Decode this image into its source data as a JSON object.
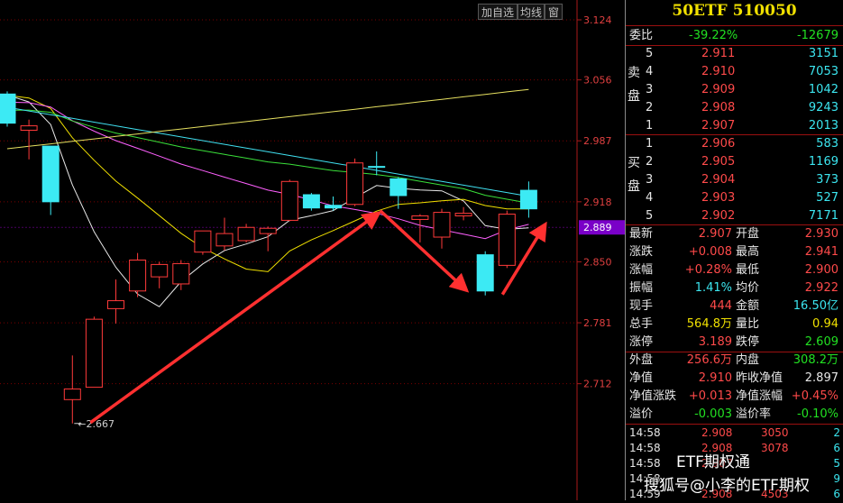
{
  "toolbar": {
    "add_watchlist": "加自选",
    "ma_line": "均线",
    "window": "窗"
  },
  "chart_data": {
    "type": "candlestick",
    "y_ticks": [
      "3.124",
      "3.056",
      "2.987",
      "2.918",
      "2.850",
      "2.781",
      "2.712"
    ],
    "ylim": [
      2.65,
      3.124
    ],
    "current_price_label": "2.889",
    "low_annotation": "2.667",
    "colors": {
      "up": "#ff3a3a",
      "down": "#3ceaf4",
      "grid": "#7a0000",
      "ma5": "#e8e8e8",
      "ma10": "#f0e000",
      "ma20": "#ff60ff",
      "ma30": "#3ae03a",
      "ma60": "#40e0f0",
      "ma120": "#e6e060",
      "current": "#7a00c8",
      "arrow": "#ff3030"
    },
    "candles": [
      {
        "o": 3.04,
        "h": 3.043,
        "c": 3.007,
        "l": 3.003
      },
      {
        "o": 2.999,
        "h": 3.011,
        "c": 3.004,
        "l": 2.966
      },
      {
        "o": 2.981,
        "h": 2.981,
        "c": 2.918,
        "l": 2.903
      },
      {
        "o": 2.694,
        "h": 2.744,
        "c": 2.706,
        "l": 2.667
      },
      {
        "o": 2.708,
        "h": 2.788,
        "c": 2.785,
        "l": 2.708
      },
      {
        "o": 2.797,
        "h": 2.83,
        "c": 2.806,
        "l": 2.78
      },
      {
        "o": 2.817,
        "h": 2.86,
        "c": 2.852,
        "l": 2.81
      },
      {
        "o": 2.833,
        "h": 2.85,
        "c": 2.847,
        "l": 2.82
      },
      {
        "o": 2.825,
        "h": 2.852,
        "c": 2.848,
        "l": 2.818
      },
      {
        "o": 2.861,
        "h": 2.88,
        "c": 2.885,
        "l": 2.858
      },
      {
        "o": 2.868,
        "h": 2.9,
        "c": 2.882,
        "l": 2.863
      },
      {
        "o": 2.874,
        "h": 2.893,
        "c": 2.889,
        "l": 2.872
      },
      {
        "o": 2.882,
        "h": 2.89,
        "c": 2.888,
        "l": 2.862
      },
      {
        "o": 2.897,
        "h": 2.943,
        "c": 2.941,
        "l": 2.896
      },
      {
        "o": 2.926,
        "h": 2.928,
        "c": 2.911,
        "l": 2.908
      },
      {
        "o": 2.914,
        "h": 2.924,
        "c": 2.911,
        "l": 2.908
      },
      {
        "o": 2.915,
        "h": 2.967,
        "c": 2.962,
        "l": 2.913
      },
      {
        "o": 2.958,
        "h": 2.975,
        "c": 2.957,
        "l": 2.948
      },
      {
        "o": 2.944,
        "h": 2.946,
        "c": 2.925,
        "l": 2.91
      },
      {
        "o": 2.898,
        "h": 2.904,
        "c": 2.902,
        "l": 2.872
      },
      {
        "o": 2.878,
        "h": 2.91,
        "c": 2.906,
        "l": 2.865
      },
      {
        "o": 2.902,
        "h": 2.912,
        "c": 2.905,
        "l": 2.897
      },
      {
        "o": 2.858,
        "h": 2.862,
        "c": 2.817,
        "l": 2.812
      },
      {
        "o": 2.846,
        "h": 2.908,
        "c": 2.904,
        "l": 2.843
      },
      {
        "o": 2.931,
        "h": 2.941,
        "c": 2.91,
        "l": 2.9
      }
    ]
  },
  "panel": {
    "title": "50ETF 510050",
    "weibi": {
      "label": "委比",
      "pct": "-39.22%",
      "diff": "-12679"
    },
    "sell_label": [
      "卖",
      "盘"
    ],
    "buy_label": [
      "买",
      "盘"
    ],
    "sell": [
      {
        "lvl": "5",
        "price": "2.911",
        "vol": "3151"
      },
      {
        "lvl": "4",
        "price": "2.910",
        "vol": "7053"
      },
      {
        "lvl": "3",
        "price": "2.909",
        "vol": "1042"
      },
      {
        "lvl": "2",
        "price": "2.908",
        "vol": "9243"
      },
      {
        "lvl": "1",
        "price": "2.907",
        "vol": "2013"
      }
    ],
    "buy": [
      {
        "lvl": "1",
        "price": "2.906",
        "vol": "583"
      },
      {
        "lvl": "2",
        "price": "2.905",
        "vol": "1169"
      },
      {
        "lvl": "3",
        "price": "2.904",
        "vol": "373"
      },
      {
        "lvl": "4",
        "price": "2.903",
        "vol": "527"
      },
      {
        "lvl": "5",
        "price": "2.902",
        "vol": "7171"
      }
    ],
    "stats": [
      {
        "l1": "最新",
        "v1": "2.907",
        "c1": "rd",
        "l2": "开盘",
        "v2": "2.930",
        "c2": "rd"
      },
      {
        "l1": "涨跌",
        "v1": "+0.008",
        "c1": "rd",
        "l2": "最高",
        "v2": "2.941",
        "c2": "rd"
      },
      {
        "l1": "涨幅",
        "v1": "+0.28%",
        "c1": "rd",
        "l2": "最低",
        "v2": "2.900",
        "c2": "rd"
      },
      {
        "l1": "振幅",
        "v1": "1.41%",
        "c1": "cy",
        "l2": "均价",
        "v2": "2.922",
        "c2": "rd"
      },
      {
        "l1": "现手",
        "v1": "444",
        "c1": "rd",
        "l2": "金额",
        "v2": "16.50亿",
        "c2": "cy"
      },
      {
        "l1": "总手",
        "v1": "564.8万",
        "c1": "yl",
        "l2": "量比",
        "v2": "0.94",
        "c2": "yl"
      },
      {
        "l1": "涨停",
        "v1": "3.189",
        "c1": "rd",
        "l2": "跌停",
        "v2": "2.609",
        "c2": "gr"
      }
    ],
    "stats2": [
      {
        "l1": "外盘",
        "v1": "256.6万",
        "c1": "rd",
        "l2": "内盘",
        "v2": "308.2万",
        "c2": "gr"
      },
      {
        "l1": "净值",
        "v1": "2.910",
        "c1": "rd",
        "l2": "昨收净值",
        "v2": "2.897",
        "c2": "wh"
      },
      {
        "l1": "净值涨跌",
        "v1": "+0.013",
        "c1": "rd",
        "l2": "净值涨幅",
        "v2": "+0.45%",
        "c2": "rd"
      },
      {
        "l1": "溢价",
        "v1": "-0.003",
        "c1": "gr",
        "l2": "溢价率",
        "v2": "-0.10%",
        "c2": "gr"
      }
    ],
    "ticks": [
      {
        "time": "14:58",
        "price": "2.908",
        "vol": "3050",
        "n": "2"
      },
      {
        "time": "14:58",
        "price": "2.908",
        "vol": "3078",
        "n": "6"
      },
      {
        "time": "14:58",
        "price": "2.907",
        "vol": "",
        "n": "5"
      },
      {
        "time": "14:58",
        "price": "",
        "vol": "",
        "n": "9"
      },
      {
        "time": "14:59",
        "price": "2.908",
        "vol": "4503",
        "n": "6"
      }
    ]
  },
  "watermark": {
    "line1": "ETF期权通",
    "line2": "搜狐号@小李的ETF期权"
  }
}
